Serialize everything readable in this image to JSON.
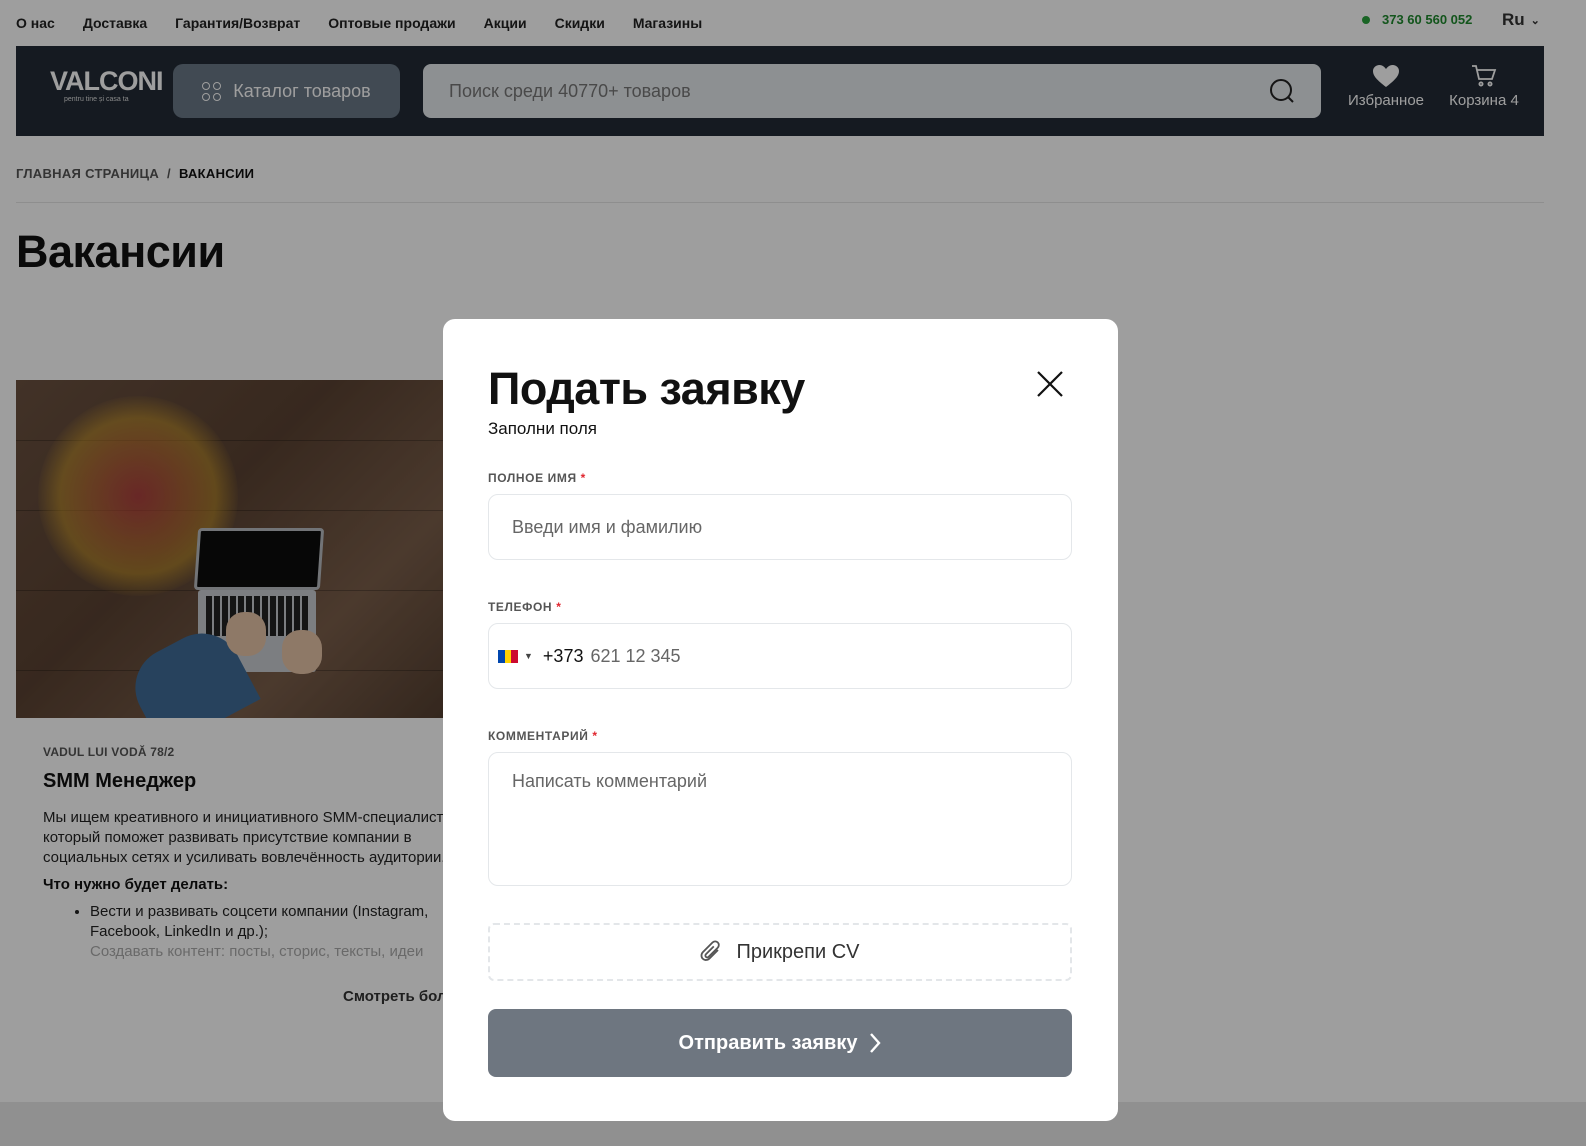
{
  "topnav": {
    "links": [
      "О нас",
      "Доставка",
      "Гарантия/Возврат",
      "Оптовые продажи",
      "Акции",
      "Скидки",
      "Магазины"
    ],
    "phone": "373 60 560 052",
    "lang": "Ru"
  },
  "header": {
    "logo_text": "VALCONI",
    "logo_tagline": "pentru tine și casa ta",
    "catalog_label": "Каталог товаров",
    "search_placeholder": "Поиск среди 40770+ товаров",
    "favorites_label": "Избранное",
    "cart_label": "Корзина 4"
  },
  "breadcrumb": {
    "home": "ГЛАВНАЯ СТРАНИЦА",
    "separator": "/",
    "current": "ВАКАНСИИ"
  },
  "page": {
    "title": "Вакансии"
  },
  "vacancy": {
    "location": "VADUL LUI VODĂ 78/2",
    "title": "SMM Менеджер",
    "description": "Мы ищем креативного и инициативного SMM-специалиста,\nкоторый поможет развивать присутствие компании в\nсоциальных сетях и усиливать вовлечённость аудитории.",
    "subheading": "Что нужно будет делать:",
    "tasks": [
      "Вести и развивать соцсети компании (Instagram, Facebook, LinkedIn и др.);",
      "Создавать контент: посты, сторис, тексты, идеи для публикаций;"
    ],
    "more_label": "Смотреть больше"
  },
  "modal": {
    "title": "Подать заявку",
    "subtitle": "Заполни поля",
    "name_label": "ПОЛНОЕ ИМЯ",
    "name_placeholder": "Введи имя и фамилию",
    "phone_label": "ТЕЛЕФОН",
    "phone_dial_code": "+373",
    "phone_placeholder": "621 12 345",
    "comment_label": "КОММЕНТАРИЙ",
    "comment_placeholder": "Написать комментарий",
    "required_mark": "*",
    "attach_label": "Прикрепи CV",
    "submit_label": "Отправить заявку"
  },
  "colors": {
    "header_bg": "#222b36",
    "catalog_btn": "#6a7886",
    "phone_green": "#1f8a2e",
    "required_red": "#e0262f",
    "submit_bg": "#6e7680",
    "overlay": "rgba(0,0,0,0.38)"
  },
  "icons": [
    "apps-grid-icon",
    "search-icon",
    "heart-icon",
    "cart-icon",
    "close-icon",
    "paperclip-icon",
    "chevron-right-icon",
    "moldova-flag-icon",
    "chevron-down-icon"
  ]
}
